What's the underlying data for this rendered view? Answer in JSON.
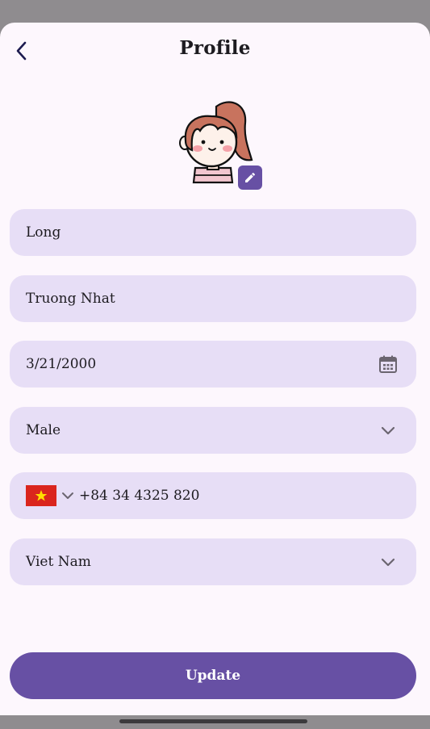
{
  "header": {
    "title": "Profile",
    "back_icon": "chevron-left-icon"
  },
  "avatar": {
    "edit_icon": "pencil-icon"
  },
  "form": {
    "first_name": "Long",
    "last_name": "Truong Nhat",
    "birth_date": "3/21/2000",
    "gender": "Male",
    "phone": {
      "flag": "Vietnam flag",
      "number": "+84 34 4325 820"
    },
    "country": "Viet Nam"
  },
  "actions": {
    "update_label": "Update"
  },
  "colors": {
    "primary": "#6750a4",
    "field_bg": "#e7def6",
    "background": "#fdf7fd",
    "icon": "#6b6570"
  }
}
